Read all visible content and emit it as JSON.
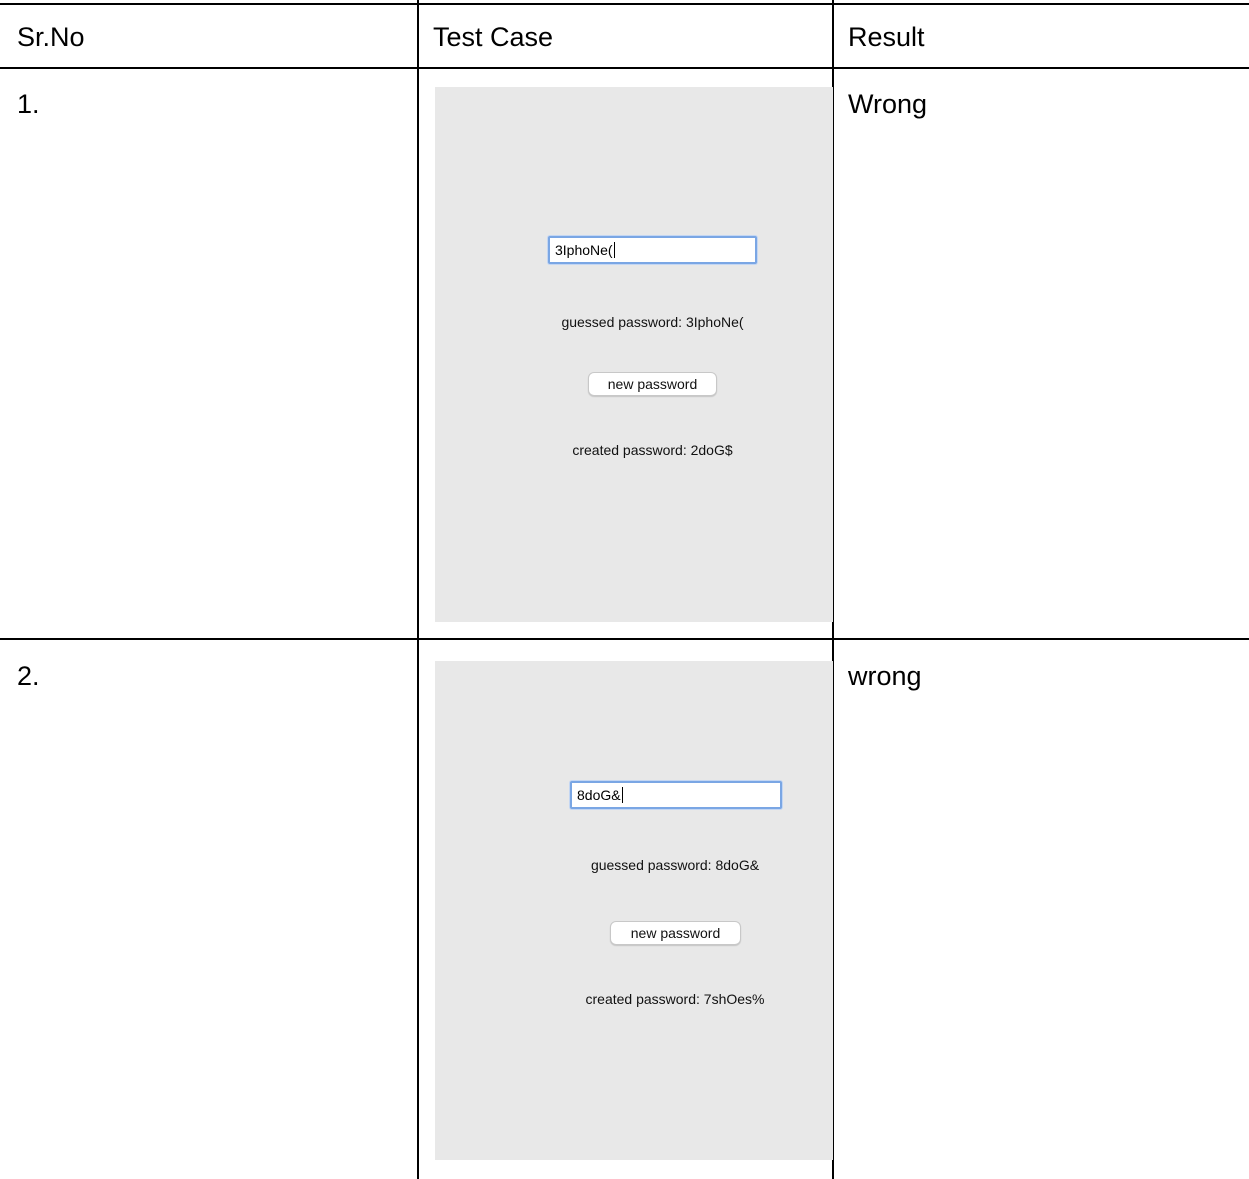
{
  "table": {
    "headers": [
      "Sr.No",
      "Test Case",
      "Result"
    ],
    "rows": [
      {
        "sr_no": "1.",
        "result": "Wrong",
        "test_case": {
          "input_value": "3IphoNe(",
          "guessed_label": "guessed password: 3IphoNe(",
          "button_label": "new password",
          "created_label": "created password: 2doG$"
        }
      },
      {
        "sr_no": "2.",
        "result": "wrong",
        "test_case": {
          "input_value": "8doG&",
          "guessed_label": "guessed password: 8doG&",
          "button_label": "new password",
          "created_label": "created password: 7shOes%"
        }
      }
    ]
  },
  "colors": {
    "grid_line": "#000000",
    "screenshot_bg": "#e8e8e8",
    "input_focus_border": "#7aa6e4"
  }
}
